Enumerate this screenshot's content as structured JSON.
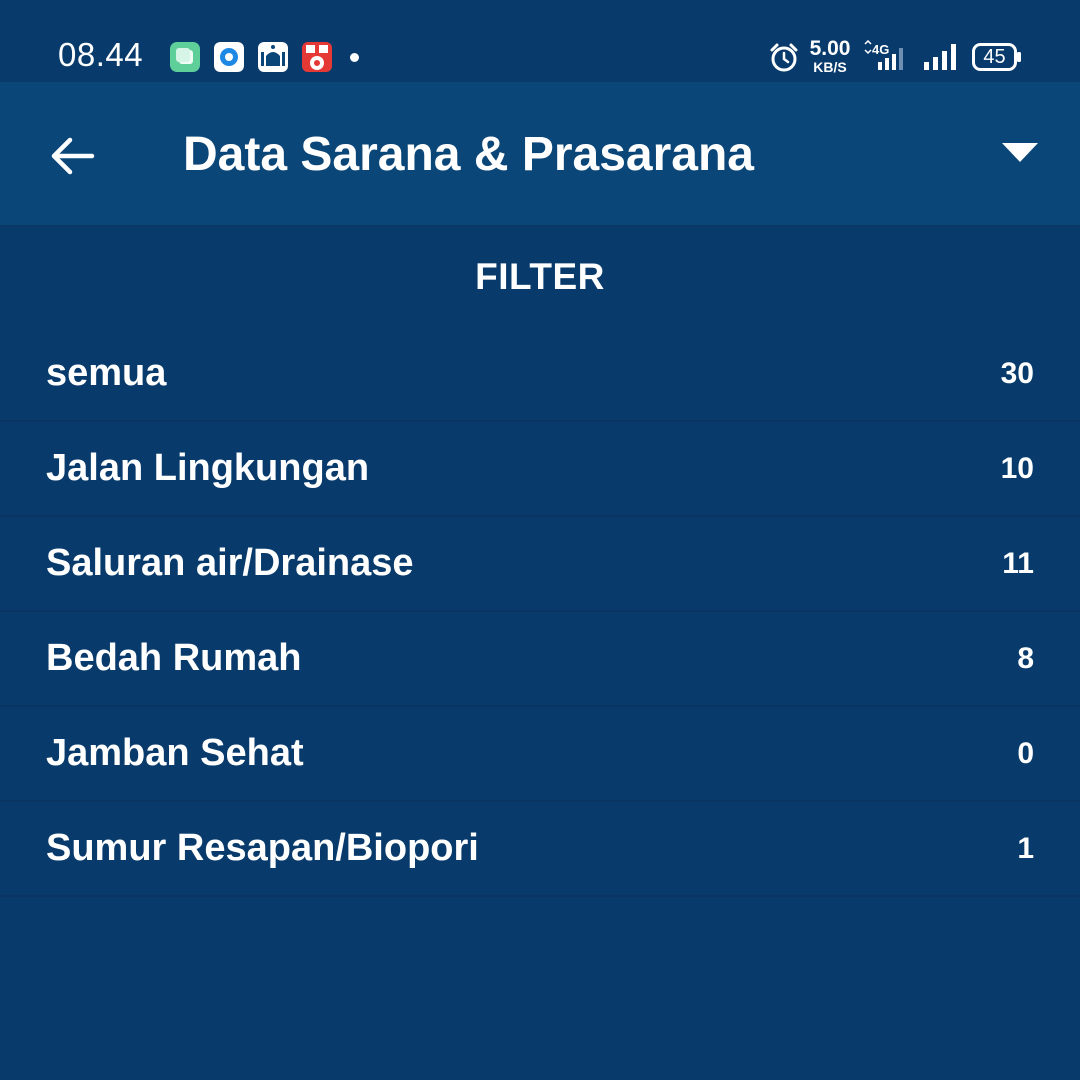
{
  "status_bar": {
    "time": "08.44",
    "net_speed_value": "5.00",
    "net_speed_unit": "KB/S",
    "network_type": "4G",
    "battery": "45",
    "icons": [
      "chat-app-icon",
      "browser-app-icon",
      "mosque-app-icon",
      "game-app-icon",
      "alarm-icon",
      "signal-icon",
      "battery-icon"
    ]
  },
  "app_bar": {
    "title": "Data Sarana & Prasarana",
    "back_icon": "arrow-left-icon",
    "menu_icon": "triangle-down-icon"
  },
  "filter": {
    "heading": "FILTER",
    "items": [
      {
        "label": "semua",
        "count": "30"
      },
      {
        "label": "Jalan Lingkungan",
        "count": "10"
      },
      {
        "label": "Saluran air/Drainase",
        "count": "11"
      },
      {
        "label": "Bedah Rumah",
        "count": "8"
      },
      {
        "label": "Jamban Sehat",
        "count": "0"
      },
      {
        "label": "Sumur Resapan/Biopori",
        "count": "1"
      }
    ]
  },
  "colors": {
    "background": "#083b6c",
    "app_bar": "#0b4678",
    "text": "#ffffff"
  }
}
